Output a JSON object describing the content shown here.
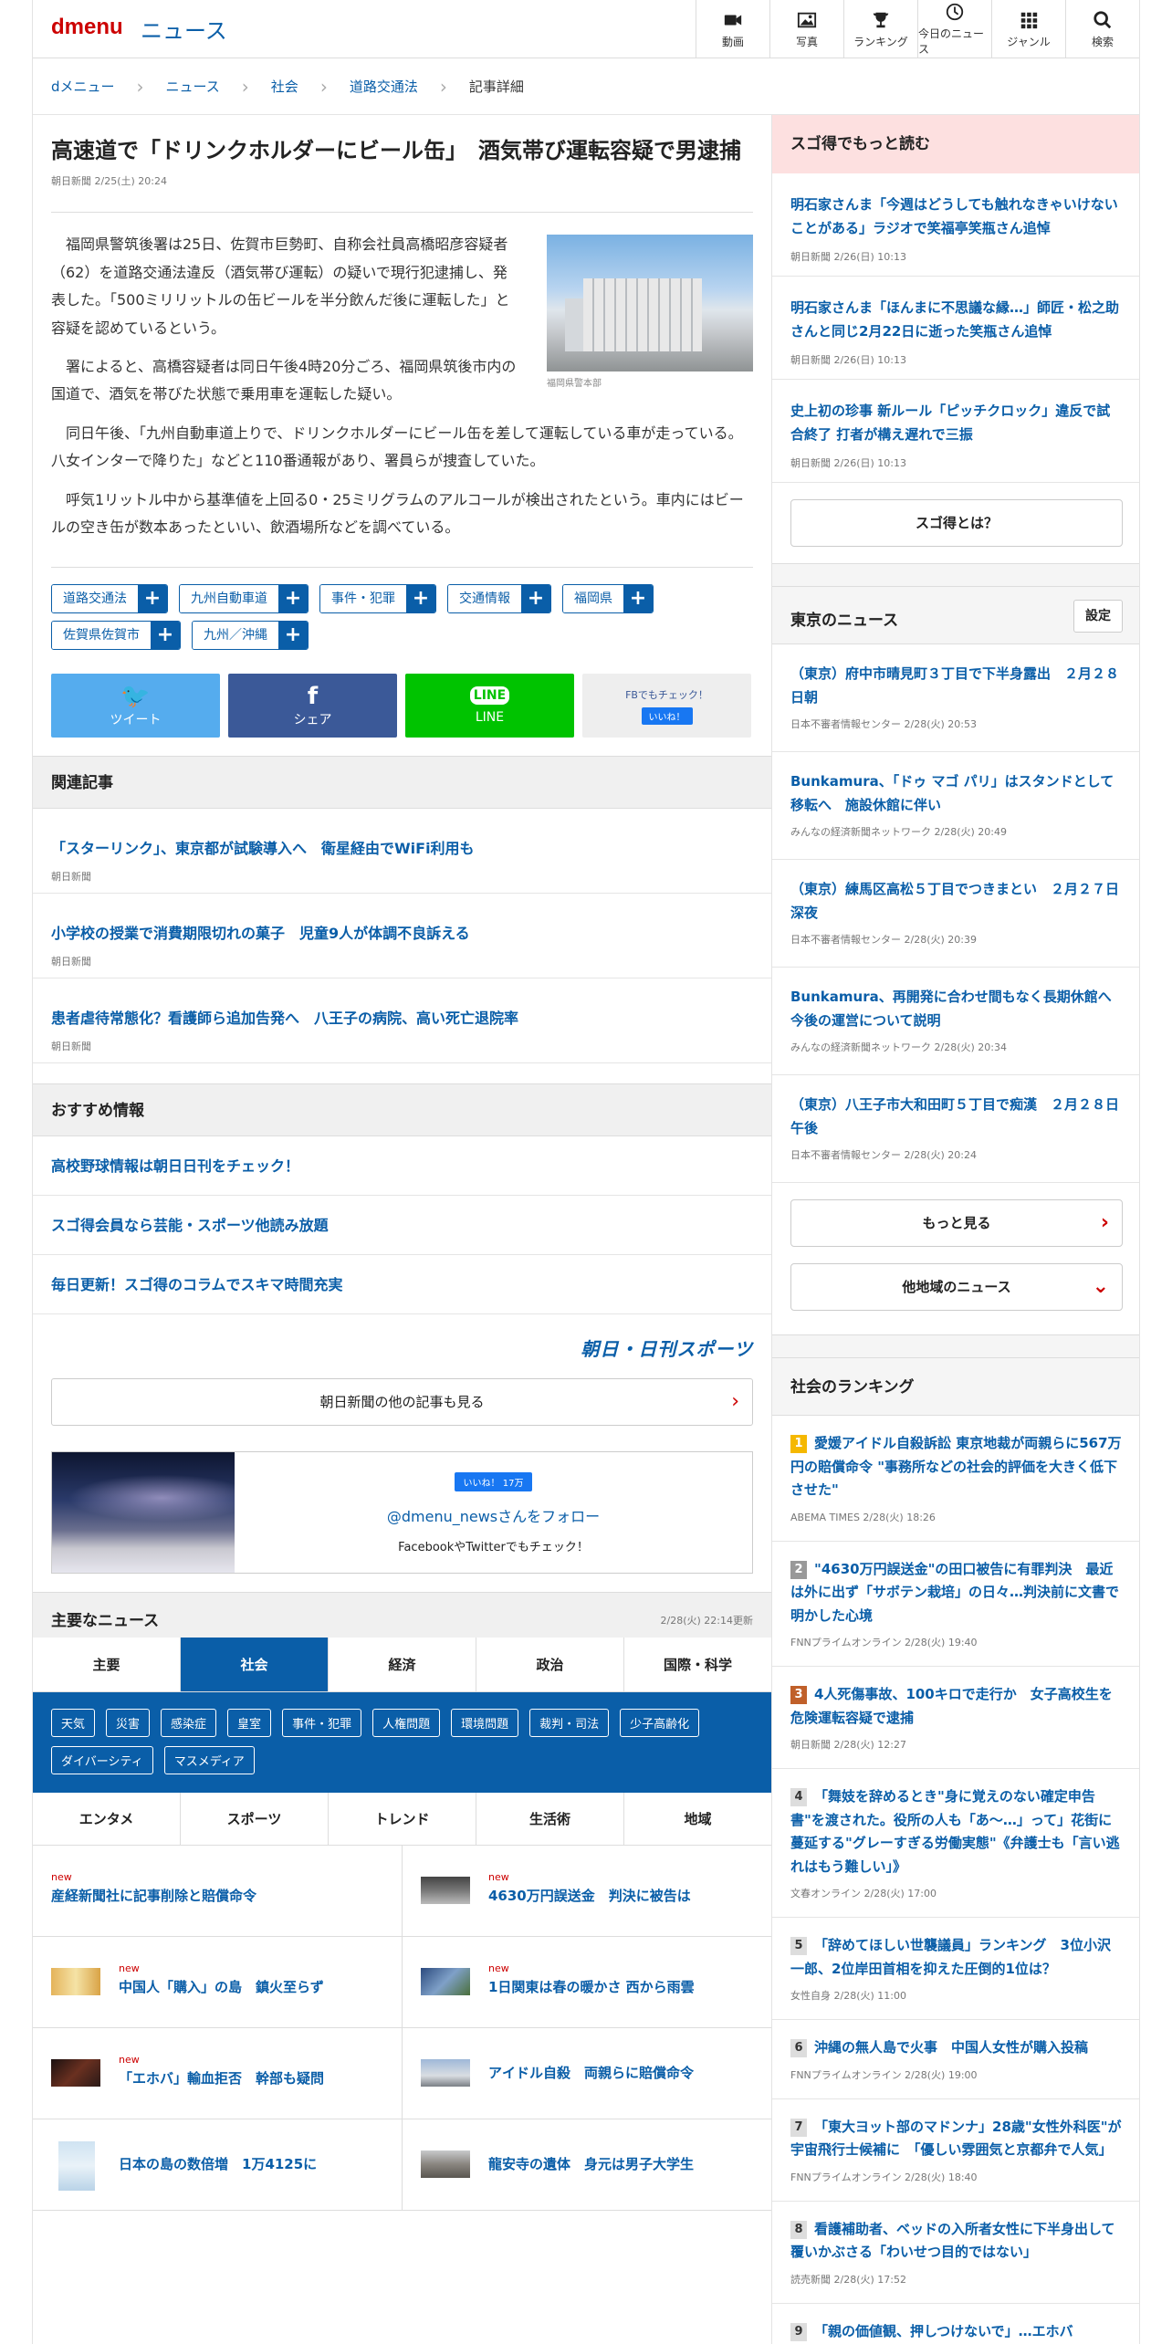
{
  "header": {
    "logo": "dmenu",
    "site": "ニュース",
    "nav": [
      {
        "label": "動画",
        "icon": "video-icon"
      },
      {
        "label": "写真",
        "icon": "photo-icon"
      },
      {
        "label": "ランキング",
        "icon": "trophy-icon"
      },
      {
        "label": "今日のニュース",
        "icon": "clock-icon"
      },
      {
        "label": "ジャンル",
        "icon": "grid-icon"
      },
      {
        "label": "検索",
        "icon": "search-icon"
      }
    ]
  },
  "breadcrumb": [
    "dメニュー",
    "ニュース",
    "社会",
    "道路交通法",
    "記事詳細"
  ],
  "article": {
    "title": "高速道で「ドリンクホルダーにビール缶」　酒気帯び運転容疑で男逮捕",
    "meta": "朝日新聞 2/25(土) 20:24",
    "photo_caption": "福岡県警本部",
    "paragraphs": [
      "福岡県警筑後署は25日、佐賀市巨勢町、自称会社員高橋昭彦容疑者（62）を道路交通法違反（酒気帯び運転）の疑いで現行犯逮捕し、発表した。「500ミリリットルの缶ビールを半分飲んだ後に運転した」と容疑を認めているという。",
      "署によると、高橋容疑者は同日午後4時20分ごろ、福岡県筑後市内の国道で、酒気を帯びた状態で乗用車を運転した疑い。",
      "同日午後、「九州自動車道上りで、ドリンクホルダーにビール缶を差して運転している車が走っている。八女インターで降りた」などと110番通報があり、署員らが捜査していた。",
      "呼気1リットル中から基準値を上回る0・25ミリグラムのアルコールが検出されたという。車内にはビールの空き缶が数本あったといい、飲酒場所などを調べている。"
    ],
    "tags": [
      "道路交通法",
      "九州自動車道",
      "事件・犯罪",
      "交通情報",
      "福岡県",
      "佐賀県佐賀市",
      "九州／沖縄"
    ]
  },
  "share": {
    "tweet": "ツイート",
    "share": "シェア",
    "line": "LINE",
    "fb_check": "FBでもチェック！",
    "like": "いいね！"
  },
  "related": {
    "title": "関連記事",
    "items": [
      {
        "title": "「スターリンク」、東京都が試験導入へ　衛星経由でWiFi利用も",
        "src": "朝日新聞"
      },
      {
        "title": "小学校の授業で消費期限切れの菓子　児童9人が体調不良訴える",
        "src": "朝日新聞"
      },
      {
        "title": "患者虐待常態化？看護師ら追加告発へ　八王子の病院、高い死亡退院率",
        "src": "朝日新聞"
      }
    ]
  },
  "recommend": {
    "title": "おすすめ情報",
    "items": [
      "高校野球情報は朝日日刊をチェック！",
      "スゴ得会員なら芸能・スポーツ他読み放題",
      "毎日更新！スゴ得のコラムでスキマ時間充実"
    ]
  },
  "brand": "朝日・日刊スポーツ",
  "more_asahi": "朝日新聞の他の記事も見る",
  "follow": {
    "like": "いいね！ 17万",
    "account": "@dmenu_newsさんをフォロー",
    "sub": "FacebookやTwitterでもチェック！"
  },
  "main_news": {
    "title": "主要なニュース",
    "updated": "2/28(火) 22:14更新",
    "tabs": [
      "主要",
      "社会",
      "経済",
      "政治",
      "国際・科学"
    ],
    "subtags": [
      "天気",
      "災害",
      "感染症",
      "皇室",
      "事件・犯罪",
      "人権問題",
      "環境問題",
      "裁判・司法",
      "少子高齢化",
      "ダイバーシティ",
      "マスメディア"
    ],
    "tabs2": [
      "エンタメ",
      "スポーツ",
      "トレンド",
      "生活術",
      "地域"
    ],
    "items": [
      {
        "title": "産経新聞社に記事削除と賠償命令",
        "new": "new"
      },
      {
        "title": "4630万円誤送金　判決に被告は",
        "new": "new"
      },
      {
        "title": "中国人「購入」の島　鎮火至らず",
        "new": "new"
      },
      {
        "title": "1日関東は春の暖かさ 西から雨雲",
        "new": "new"
      },
      {
        "title": "「エホバ」輸血拒否　幹部も疑問",
        "new": "new"
      },
      {
        "title": "アイドル自殺　両親らに賠償命令",
        "new": ""
      },
      {
        "title": "日本の島の数倍増　1万4125に",
        "new": ""
      },
      {
        "title": "龍安寺の遺体　身元は男子大学生",
        "new": ""
      }
    ]
  },
  "sugotoku": {
    "title": "スゴ得でもっと読む",
    "items": [
      {
        "title": "明石家さんま「今週はどうしても触れなきゃいけないことがある」ラジオで笑福亭笑瓶さん追悼",
        "src": "朝日新聞 2/26(日) 10:13"
      },
      {
        "title": "明石家さんま「ほんまに不思議な縁…」師匠・松之助さんと同じ2月22日に逝った笑瓶さん追悼",
        "src": "朝日新聞 2/26(日) 10:13"
      },
      {
        "title": "史上初の珍事 新ルール「ピッチクロック」違反で試合終了 打者が構え遅れで三振",
        "src": "朝日新聞 2/26(日) 10:13"
      }
    ],
    "button": "スゴ得とは？"
  },
  "tokyo": {
    "title": "東京のニュース",
    "setting": "設定",
    "items": [
      {
        "title": "（東京）府中市晴見町３丁目で下半身露出　２月２８日朝",
        "src": "日本不審者情報センター 2/28(火) 20:53"
      },
      {
        "title": "Bunkamura、「ドゥ マゴ パリ」はスタンドとして移転へ　施設休館に伴い",
        "src": "みんなの経済新聞ネットワーク 2/28(火) 20:49"
      },
      {
        "title": "（東京）練馬区高松５丁目でつきまとい　２月２７日深夜",
        "src": "日本不審者情報センター 2/28(火) 20:39"
      },
      {
        "title": "Bunkamura、再開発に合わせ間もなく長期休館へ　今後の運営について説明",
        "src": "みんなの経済新聞ネットワーク 2/28(火) 20:34"
      },
      {
        "title": "（東京）八王子市大和田町５丁目で痴漢　２月２８日午後",
        "src": "日本不審者情報センター 2/28(火) 20:24"
      }
    ],
    "more": "もっと見る",
    "other": "他地域のニュース"
  },
  "ranking": {
    "title": "社会のランキング",
    "items": [
      {
        "n": "1",
        "title": "愛媛アイドル自殺訴訟 東京地裁が両親らに567万円の賠償命令 \"事務所などの社会的評価を大きく低下させた\"",
        "src": "ABEMA TIMES 2/28(火) 18:26"
      },
      {
        "n": "2",
        "title": "\"4630万円誤送金\"の田口被告に有罪判決　最近は外に出ず「サボテン栽培」の日々…判決前に文書で明かした心境",
        "src": "FNNプライムオンライン 2/28(火) 19:40"
      },
      {
        "n": "3",
        "title": "4人死傷事故、100キロで走行か　女子高校生を危険運転容疑で逮捕",
        "src": "朝日新聞 2/28(火) 12:27"
      },
      {
        "n": "4",
        "title": "「舞妓を辞めるとき\"身に覚えのない確定申告書\"を渡された。役所の人も「あ〜…」って」花街に蔓延する\"グレーすぎる労働実態\"《弁護士も「言い逃れはもう難しい」》",
        "src": "文春オンライン 2/28(火) 17:00"
      },
      {
        "n": "5",
        "title": "「辞めてほしい世襲議員」ランキング　3位小沢一郎、2位岸田首相を抑えた圧倒的1位は？",
        "src": "女性自身 2/28(火) 11:00"
      },
      {
        "n": "6",
        "title": "沖縄の無人島で火事　中国人女性が購入投稿",
        "src": "FNNプライムオンライン 2/28(火) 19:00"
      },
      {
        "n": "7",
        "title": "「東大ヨット部のマドンナ」28歳\"女性外科医\"が宇宙飛行士候補に　「優しい雰囲気と京都弁で人気」",
        "src": "FNNプライムオンライン 2/28(火) 18:40"
      },
      {
        "n": "8",
        "title": "看護補助者、ベッドの入所者女性に下半身出して覆いかぶさる「わいせつ目的ではない」",
        "src": "読売新聞 2/28(火) 17:52"
      },
      {
        "n": "9",
        "title": "「親の価値観、押しつけないで」…エホバ",
        "src": ""
      }
    ]
  }
}
